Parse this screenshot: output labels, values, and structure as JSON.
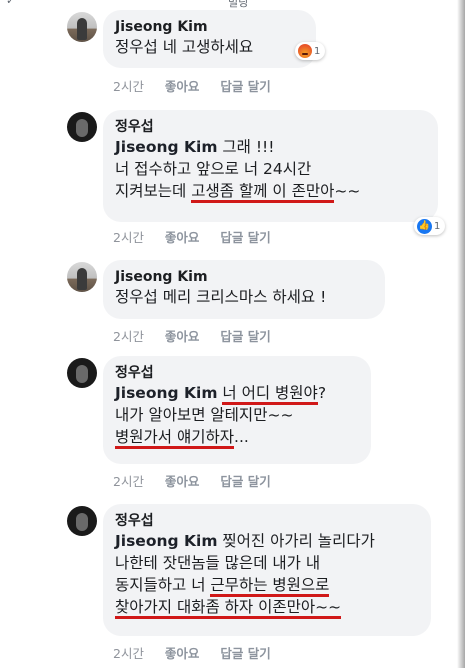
{
  "top_partial": {
    "left": "✓",
    "center": "빌딩"
  },
  "comments": [
    {
      "author": "Jiseong Kim",
      "lines": [
        [
          {
            "t": "정우섭 네 고생하세요 ",
            "tag": false,
            "ul": false
          }
        ]
      ],
      "reaction": {
        "icon": "angry-emoji-icon",
        "count": "1"
      },
      "time": "2시간",
      "like": "좋아요",
      "reply": "답글 달기"
    },
    {
      "author": "정우섭",
      "lines": [
        [
          {
            "t": "Jiseong Kim",
            "tag": true,
            "ul": false
          },
          {
            "t": " 그래 !!!",
            "tag": false,
            "ul": false
          }
        ],
        [
          {
            "t": "너 접수하고 앞으로 너 24시간",
            "tag": false,
            "ul": false
          }
        ],
        [
          {
            "t": "지켜보는데 ",
            "tag": false,
            "ul": false
          },
          {
            "t": "고생좀 할께 이 존만아",
            "tag": false,
            "ul": true
          },
          {
            "t": "~~",
            "tag": false,
            "ul": false
          }
        ]
      ],
      "reaction": {
        "icon": "like-emoji-icon",
        "count": "1"
      },
      "time": "2시간",
      "like": "좋아요",
      "reply": "답글 달기"
    },
    {
      "author": "Jiseong Kim",
      "lines": [
        [
          {
            "t": "정우섭 메리 크리스마스 하세요 !",
            "tag": false,
            "ul": false
          }
        ]
      ],
      "time": "2시간",
      "like": "좋아요",
      "reply": "답글 달기"
    },
    {
      "author": "정우섭",
      "lines": [
        [
          {
            "t": "Jiseong Kim",
            "tag": true,
            "ul": false
          },
          {
            "t": " ",
            "tag": false,
            "ul": false
          },
          {
            "t": "너 어디 병원야",
            "tag": false,
            "ul": true
          },
          {
            "t": "?",
            "tag": false,
            "ul": false
          }
        ],
        [
          {
            "t": "내가 알아보면 알테지만~~",
            "tag": false,
            "ul": false
          }
        ],
        [
          {
            "t": "병원가서 얘기하자",
            "tag": false,
            "ul": true
          },
          {
            "t": "...",
            "tag": false,
            "ul": false
          }
        ]
      ],
      "time": "2시간",
      "like": "좋아요",
      "reply": "답글 달기"
    },
    {
      "author": "정우섭",
      "lines": [
        [
          {
            "t": "Jiseong Kim",
            "tag": true,
            "ul": false
          },
          {
            "t": " 찢어진 아가리 놀리다가",
            "tag": false,
            "ul": false
          }
        ],
        [
          {
            "t": "나한테 잣댄놈들 많은데 내가 내",
            "tag": false,
            "ul": false
          }
        ],
        [
          {
            "t": "동지들하고 너 ",
            "tag": false,
            "ul": false
          },
          {
            "t": "근무하는 병원으로",
            "tag": false,
            "ul": true
          }
        ],
        [
          {
            "t": "찾아가지 대화좀 하자 이존만아~~",
            "tag": false,
            "ul": true
          }
        ]
      ],
      "time": "2시간",
      "like": "좋아요",
      "reply": "답글 달기"
    }
  ]
}
